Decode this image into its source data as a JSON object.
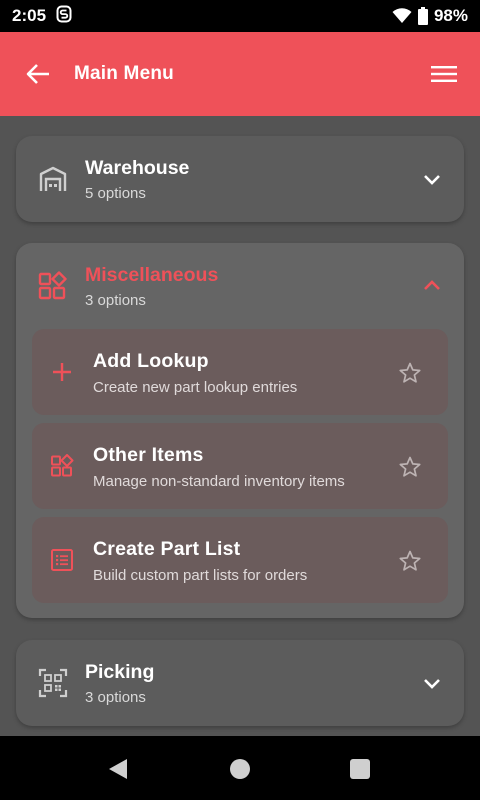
{
  "status_bar": {
    "time": "2:05",
    "battery": "98%",
    "icons": [
      "sync-icon",
      "wifi-icon",
      "battery-icon"
    ]
  },
  "app_bar": {
    "title": "Main Menu",
    "back_icon": "arrow-left-icon",
    "menu_icon": "hamburger-menu-icon"
  },
  "colors": {
    "accent": "#ef5159",
    "background": "#545454",
    "card": "#5c5c5c",
    "option": "#6b5c5c"
  },
  "categories": [
    {
      "title": "Warehouse",
      "subtitle": "5 options",
      "icon": "warehouse-icon",
      "expanded": false
    },
    {
      "title": "Miscellaneous",
      "subtitle": "3 options",
      "icon": "grid-shapes-icon",
      "expanded": true,
      "options": [
        {
          "title": "Add Lookup",
          "subtitle": "Create new part lookup entries",
          "icon": "plus-icon"
        },
        {
          "title": "Other Items",
          "subtitle": "Manage non-standard inventory items",
          "icon": "grid-shapes-icon"
        },
        {
          "title": "Create Part List",
          "subtitle": "Build custom part lists for orders",
          "icon": "list-icon"
        }
      ]
    },
    {
      "title": "Picking",
      "subtitle": "3 options",
      "icon": "qr-code-icon",
      "expanded": false
    }
  ],
  "nav_bar": {
    "icons": [
      "back-triangle-icon",
      "home-circle-icon",
      "recents-square-icon"
    ]
  }
}
